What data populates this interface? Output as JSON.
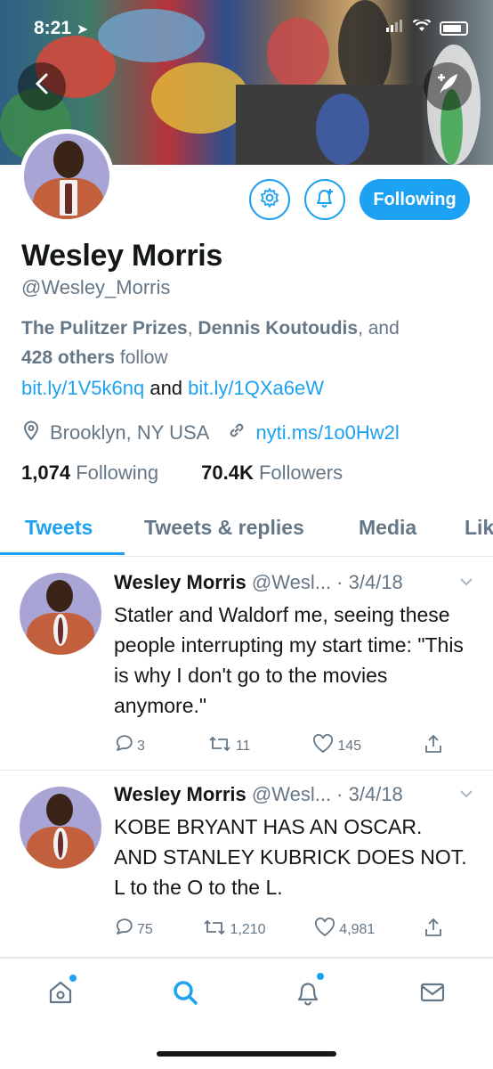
{
  "status_bar": {
    "time": "8:21",
    "location_arrow": "location-arrow-icon"
  },
  "profile": {
    "name": "Wesley Morris",
    "handle": "@Wesley_Morris",
    "followed_by_prefix": "The Pulitzer Prizes",
    "followed_by_second": "Dennis Koutoudis",
    "followed_by_and": ", and",
    "followed_by_others": "428 others",
    "followed_by_suffix": "follow",
    "bio_link1": "bit.ly/1V5k6nq",
    "bio_and": "and",
    "bio_link2": "bit.ly/1QXa6eW",
    "location": "Brooklyn, NY USA",
    "website": "nyti.ms/1o0Hw2l",
    "following_count": "1,074",
    "following_label": "Following",
    "followers_count": "70.4K",
    "followers_label": "Followers",
    "follow_button_label": "Following"
  },
  "tabs": [
    {
      "label": "Tweets",
      "active": true
    },
    {
      "label": "Tweets & replies",
      "active": false
    },
    {
      "label": "Media",
      "active": false
    },
    {
      "label": "Lik",
      "active": false
    }
  ],
  "tweets": [
    {
      "name": "Wesley Morris",
      "handle_date": "@Wesl... · 3/4/18",
      "text": "Statler and Waldorf me, seeing these people interrupting my start time: \"This is why I don't go to the movies anymore.\"",
      "replies": "3",
      "retweets": "11",
      "likes": "145"
    },
    {
      "name": "Wesley Morris",
      "handle_date": "@Wesl... · 3/4/18",
      "text": "KOBE BRYANT HAS AN OSCAR. AND STANLEY KUBRICK DOES NOT. L to the O to the L.",
      "replies": "75",
      "retweets": "1,210",
      "likes": "4,981"
    }
  ],
  "nav": {
    "items": [
      "home-icon",
      "search-icon",
      "notifications-icon",
      "messages-icon"
    ],
    "accent": "#1da1f2"
  },
  "colors": {
    "accent": "#1da1f2",
    "secondary_text": "#657786",
    "primary_text": "#14171a"
  }
}
